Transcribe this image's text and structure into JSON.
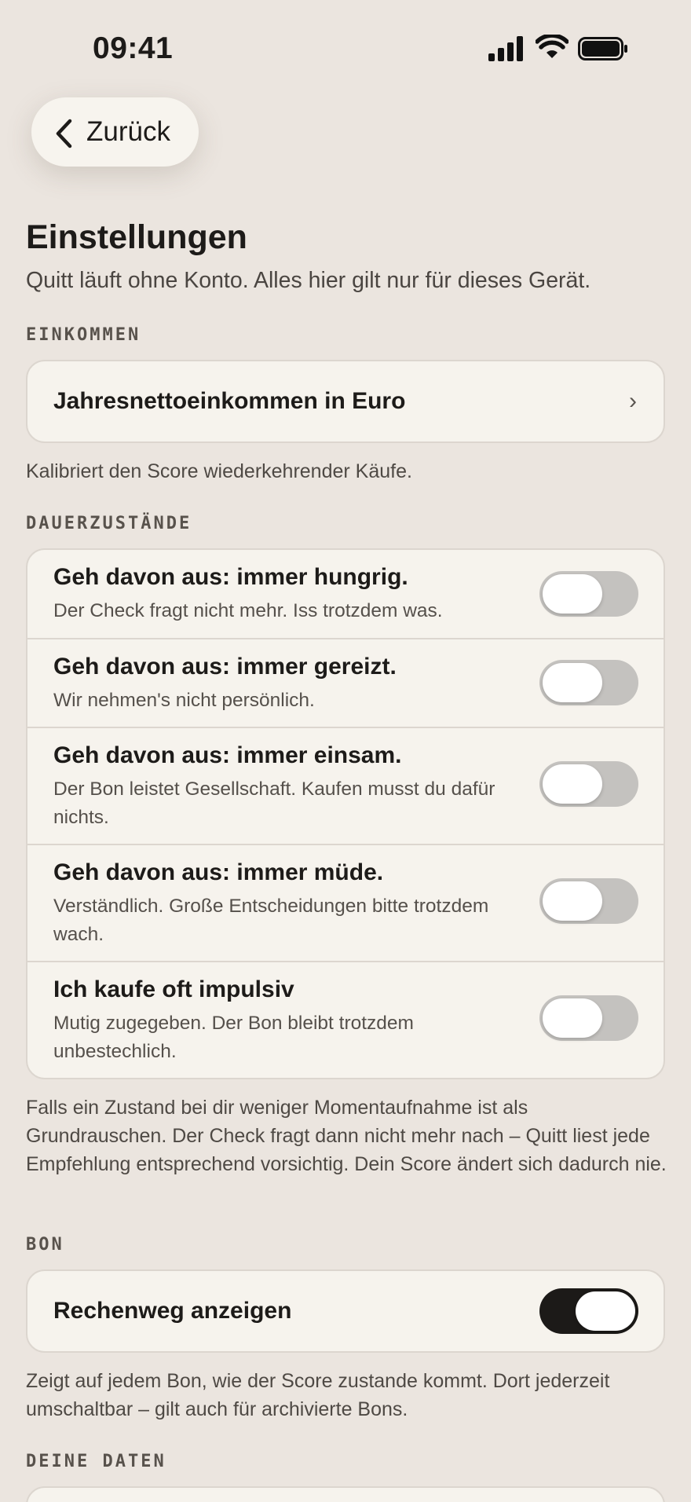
{
  "status": {
    "time": "09:41"
  },
  "nav": {
    "back_label": "Zurück"
  },
  "header": {
    "title": "Einstellungen",
    "subtitle": "Quitt läuft ohne Konto. Alles hier gilt nur für dieses Gerät."
  },
  "income": {
    "section_label": "EINKOMMEN",
    "row_label": "Jahresnettoeinkommen in Euro",
    "helper": "Kalibriert den Score wiederkehrender Käufe."
  },
  "states": {
    "section_label": "DAUERZUSTÄNDE",
    "items": [
      {
        "title": "Geh davon aus: immer hungrig.",
        "desc": "Der Check fragt nicht mehr. Iss trotzdem was.",
        "enabled": false
      },
      {
        "title": "Geh davon aus: immer gereizt.",
        "desc": "Wir nehmen's nicht persönlich.",
        "enabled": false
      },
      {
        "title": "Geh davon aus: immer einsam.",
        "desc": "Der Bon leistet Gesellschaft. Kaufen musst du dafür nichts.",
        "enabled": false
      },
      {
        "title": "Geh davon aus: immer müde.",
        "desc": "Verständlich. Große Entscheidungen bitte trotzdem wach.",
        "enabled": false
      },
      {
        "title": "Ich kaufe oft impulsiv",
        "desc": "Mutig zugegeben. Der Bon bleibt trotzdem unbestechlich.",
        "enabled": false
      }
    ],
    "helper": "Falls ein Zustand bei dir weniger Momentaufnahme ist als Grundrauschen. Der Check fragt dann nicht mehr nach – Quitt liest jede Empfehlung entsprechend vorsichtig. Dein Score ändert sich dadurch nie."
  },
  "receipt": {
    "section_label": "BON",
    "row_label": "Rechenweg anzeigen",
    "enabled": true,
    "helper": "Zeigt auf jedem Bon, wie der Score zustande kommt. Dort jederzeit umschaltbar – gilt auch für archivierte Bons."
  },
  "data_section": {
    "section_label": "DEINE DATEN"
  },
  "icons": {
    "signal": "cellular-signal-icon",
    "wifi": "wifi-icon",
    "battery": "battery-icon",
    "back": "chevron-left-icon",
    "row_chevron": "chevron-right-icon"
  }
}
